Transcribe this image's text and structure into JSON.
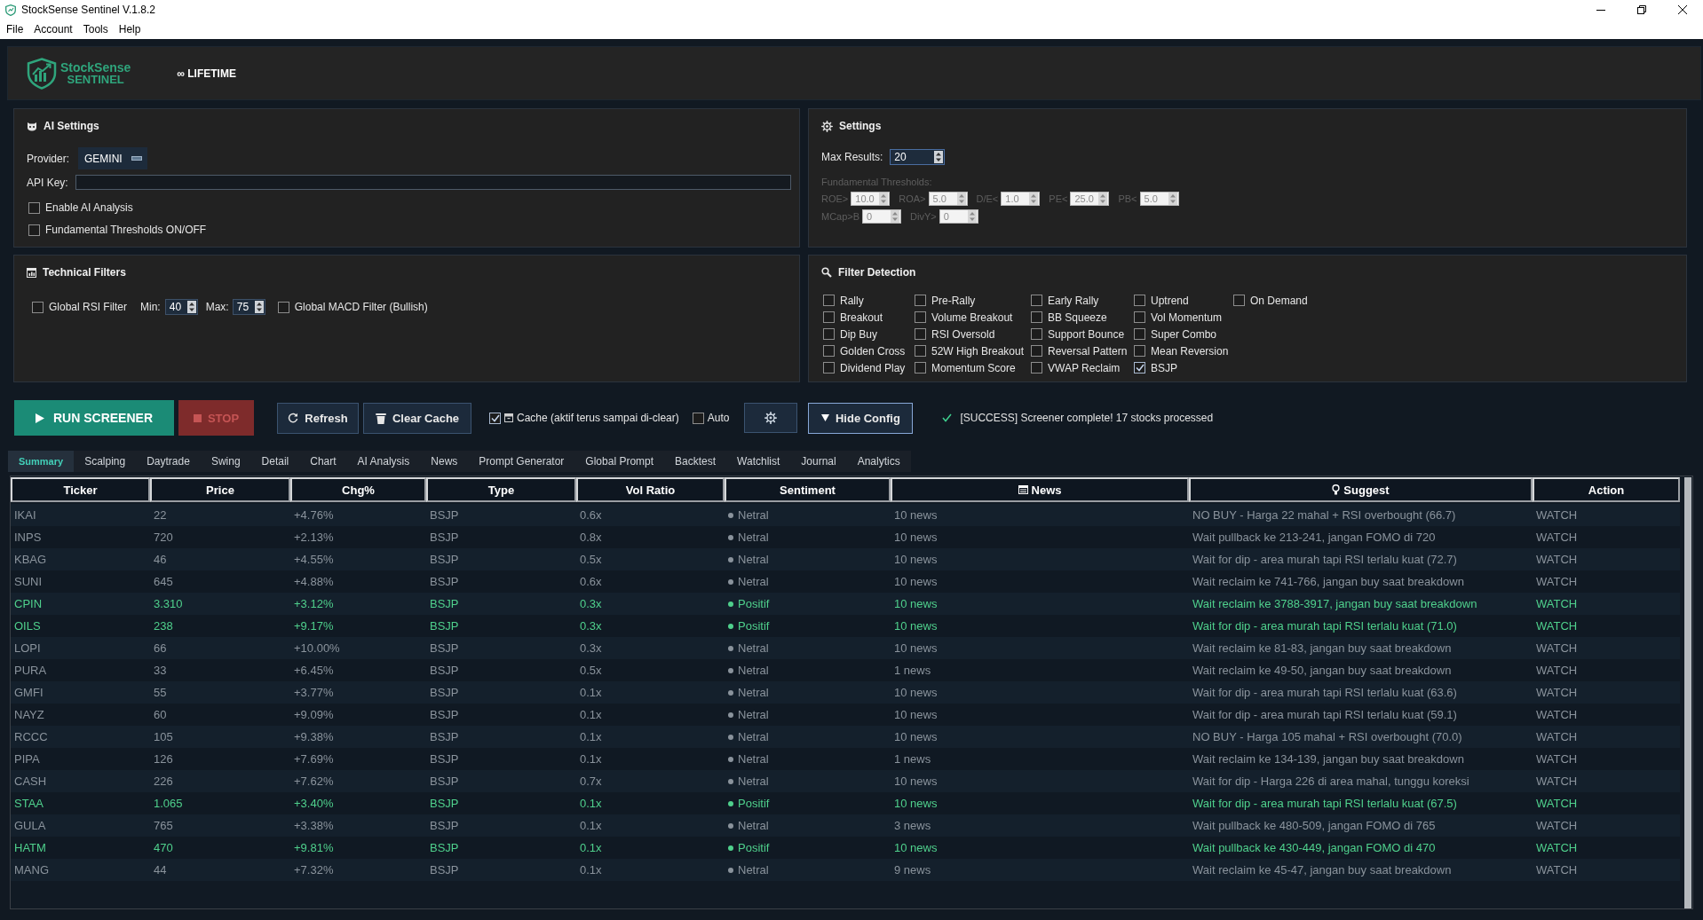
{
  "window": {
    "title": "StockSense Sentinel V.1.8.2"
  },
  "menu": [
    "File",
    "Account",
    "Tools",
    "Help"
  ],
  "header": {
    "logo_title": "StockSense",
    "logo_subtitle": "SENTINEL",
    "license": "∞ LIFETIME"
  },
  "ai_settings": {
    "title": "AI Settings",
    "provider_label": "Provider:",
    "provider": "GEMINI",
    "api_key_label": "API Key:",
    "checkboxes": [
      {
        "label": "Enable AI Analysis",
        "checked": false
      },
      {
        "label": "Fundamental Thresholds ON/OFF",
        "checked": false
      }
    ]
  },
  "settings": {
    "title": "Settings",
    "max_results_label": "Max Results:",
    "max_results": "20",
    "thresholds": {
      "label": "Fundamental Thresholds:",
      "disabled": true,
      "rows": [
        [
          {
            "label": "ROE>",
            "value": "10.0"
          },
          {
            "label": "ROA>",
            "value": "5.0"
          },
          {
            "label": "D/E<",
            "value": "1.0"
          },
          {
            "label": "PE<",
            "value": "25.0"
          },
          {
            "label": "PB<",
            "value": "5.0"
          }
        ],
        [
          {
            "label": "MCap>B",
            "value": "0"
          },
          {
            "label": "DivY>",
            "value": "0"
          }
        ]
      ]
    }
  },
  "technical_filters": {
    "title": "Technical Filters",
    "rsi_filter": {
      "label": "Global RSI Filter",
      "checked": false
    },
    "min_label": "Min:",
    "min": "40",
    "max_label": "Max:",
    "max": "75",
    "macd_filter": {
      "label": "Global MACD Filter (Bullish)",
      "checked": false
    }
  },
  "filter_detection": {
    "title": "Filter Detection",
    "columns": [
      [
        {
          "label": "Rally",
          "checked": false
        },
        {
          "label": "Breakout",
          "checked": false
        },
        {
          "label": "Dip Buy",
          "checked": false
        },
        {
          "label": "Golden Cross",
          "checked": false
        },
        {
          "label": "Dividend Play",
          "checked": false
        }
      ],
      [
        {
          "label": "Pre-Rally",
          "checked": false
        },
        {
          "label": "Volume Breakout",
          "checked": false
        },
        {
          "label": "RSI Oversold",
          "checked": false
        },
        {
          "label": "52W High Breakout",
          "checked": false
        },
        {
          "label": "Momentum Score",
          "checked": false
        }
      ],
      [
        {
          "label": "Early Rally",
          "checked": false
        },
        {
          "label": "BB Squeeze",
          "checked": false
        },
        {
          "label": "Support Bounce",
          "checked": false
        },
        {
          "label": "Reversal Pattern",
          "checked": false
        },
        {
          "label": "VWAP Reclaim",
          "checked": false
        }
      ],
      [
        {
          "label": "Uptrend",
          "checked": false
        },
        {
          "label": "Vol Momentum",
          "checked": false
        },
        {
          "label": "Super Combo",
          "checked": false
        },
        {
          "label": "Mean Reversion",
          "checked": false
        },
        {
          "label": "BSJP",
          "checked": true
        }
      ],
      [
        {
          "label": "On Demand",
          "checked": false
        }
      ]
    ]
  },
  "toolbar": {
    "items": [
      {
        "kind": "run",
        "label": "RUN SCREENER",
        "disabled": false
      },
      {
        "kind": "stop",
        "label": "STOP",
        "disabled": true
      },
      {
        "kind": "refresh",
        "label": "Refresh",
        "disabled": false
      },
      {
        "kind": "clear",
        "label": "Clear Cache",
        "disabled": false
      },
      {
        "kind": "cache",
        "label": "Cache (aktif terus sampai di-clear)",
        "checked": true
      },
      {
        "kind": "checkbox",
        "label": "Auto",
        "checked": false
      },
      {
        "kind": "settings",
        "disabled": false
      },
      {
        "kind": "collapse",
        "label": "Hide Config",
        "disabled": false
      }
    ],
    "status": "[SUCCESS] Screener complete! 17 stocks processed"
  },
  "tabs": [
    {
      "label": "Summary",
      "selected": true
    },
    {
      "label": "Scalping",
      "selected": false
    },
    {
      "label": "Daytrade",
      "selected": false
    },
    {
      "label": "Swing",
      "selected": false
    },
    {
      "label": "Detail",
      "selected": false
    },
    {
      "label": "Chart",
      "selected": false
    },
    {
      "label": "AI Analysis",
      "selected": false
    },
    {
      "label": "News",
      "selected": false
    },
    {
      "label": "Prompt Generator",
      "selected": false
    },
    {
      "label": "Global Prompt",
      "selected": false
    },
    {
      "label": "Backtest",
      "selected": false
    },
    {
      "label": "Watchlist",
      "selected": false
    },
    {
      "label": "Journal",
      "selected": false
    },
    {
      "label": "Analytics",
      "selected": false
    }
  ],
  "table": {
    "columns": [
      {
        "label": "Ticker",
        "kind": "text"
      },
      {
        "label": "Price",
        "kind": "text"
      },
      {
        "label": "Chg%",
        "kind": "text"
      },
      {
        "label": "Type",
        "kind": "text"
      },
      {
        "label": "Vol Ratio",
        "kind": "text"
      },
      {
        "label": "Sentiment",
        "kind": "sentiment"
      },
      {
        "label": "News",
        "kind": "news"
      },
      {
        "label": "Suggest",
        "kind": "suggest"
      },
      {
        "label": "Action",
        "kind": "text"
      }
    ],
    "rows": [
      {
        "color": "#8a939c",
        "cells": [
          "IKAI",
          "22",
          "+4.76%",
          "BSJP",
          "0.6x",
          "Netral",
          "10 news",
          "NO BUY - Harga 22 mahal + RSI overbought (66.7)",
          "WATCH"
        ]
      },
      {
        "color": "#8a939c",
        "cells": [
          "INPS",
          "720",
          "+2.13%",
          "BSJP",
          "0.8x",
          "Netral",
          "10 news",
          "Wait pullback ke 213-241, jangan FOMO di 720",
          "WATCH"
        ]
      },
      {
        "color": "#8a939c",
        "cells": [
          "KBAG",
          "46",
          "+4.55%",
          "BSJP",
          "0.5x",
          "Netral",
          "10 news",
          "Wait for dip - area murah tapi RSI terlalu kuat (72.7)",
          "WATCH"
        ]
      },
      {
        "color": "#8a939c",
        "cells": [
          "SUNI",
          "645",
          "+4.88%",
          "BSJP",
          "0.6x",
          "Netral",
          "10 news",
          "Wait reclaim ke 741-766, jangan buy saat breakdown",
          "WATCH"
        ]
      },
      {
        "color": "#4fd08c",
        "cells": [
          "CPIN",
          "3.310",
          "+3.12%",
          "BSJP",
          "0.3x",
          "Positif",
          "10 news",
          "Wait reclaim ke 3788-3917, jangan buy saat breakdown",
          "WATCH"
        ]
      },
      {
        "color": "#4fd08c",
        "cells": [
          "OILS",
          "238",
          "+9.17%",
          "BSJP",
          "0.3x",
          "Positif",
          "10 news",
          "Wait for dip - area murah tapi RSI terlalu kuat (71.0)",
          "WATCH"
        ]
      },
      {
        "color": "#8a939c",
        "cells": [
          "LOPI",
          "66",
          "+10.00%",
          "BSJP",
          "0.3x",
          "Netral",
          "10 news",
          "Wait reclaim ke 81-83, jangan buy saat breakdown",
          "WATCH"
        ]
      },
      {
        "color": "#8a939c",
        "cells": [
          "PURA",
          "33",
          "+6.45%",
          "BSJP",
          "0.5x",
          "Netral",
          "1 news",
          "Wait reclaim ke 49-50, jangan buy saat breakdown",
          "WATCH"
        ]
      },
      {
        "color": "#8a939c",
        "cells": [
          "GMFI",
          "55",
          "+3.77%",
          "BSJP",
          "0.1x",
          "Netral",
          "10 news",
          "Wait for dip - area murah tapi RSI terlalu kuat (63.6)",
          "WATCH"
        ]
      },
      {
        "color": "#8a939c",
        "cells": [
          "NAYZ",
          "60",
          "+9.09%",
          "BSJP",
          "0.1x",
          "Netral",
          "10 news",
          "Wait for dip - area murah tapi RSI terlalu kuat (59.1)",
          "WATCH"
        ]
      },
      {
        "color": "#8a939c",
        "cells": [
          "RCCC",
          "105",
          "+9.38%",
          "BSJP",
          "0.1x",
          "Netral",
          "10 news",
          "NO BUY - Harga 105 mahal + RSI overbought (70.0)",
          "WATCH"
        ]
      },
      {
        "color": "#8a939c",
        "cells": [
          "PIPA",
          "126",
          "+7.69%",
          "BSJP",
          "0.1x",
          "Netral",
          "1 news",
          "Wait reclaim ke 134-139, jangan buy saat breakdown",
          "WATCH"
        ]
      },
      {
        "color": "#8a939c",
        "cells": [
          "CASH",
          "226",
          "+7.62%",
          "BSJP",
          "0.7x",
          "Netral",
          "10 news",
          "Wait for dip - Harga 226 di area mahal, tunggu koreksi",
          "WATCH"
        ]
      },
      {
        "color": "#4fd08c",
        "cells": [
          "STAA",
          "1.065",
          "+3.40%",
          "BSJP",
          "0.1x",
          "Positif",
          "10 news",
          "Wait for dip - area murah tapi RSI terlalu kuat (67.5)",
          "WATCH"
        ]
      },
      {
        "color": "#8a939c",
        "cells": [
          "GULA",
          "765",
          "+3.38%",
          "BSJP",
          "0.1x",
          "Netral",
          "3 news",
          "Wait pullback ke 480-509, jangan FOMO di 765",
          "WATCH"
        ]
      },
      {
        "color": "#4fd08c",
        "cells": [
          "HATM",
          "470",
          "+9.81%",
          "BSJP",
          "0.1x",
          "Positif",
          "10 news",
          "Wait pullback ke 430-449, jangan FOMO di 470",
          "WATCH"
        ]
      },
      {
        "color": "#8a939c",
        "cells": [
          "MANG",
          "44",
          "+7.32%",
          "BSJP",
          "0.1x",
          "Netral",
          "9 news",
          "Wait reclaim ke 45-47, jangan buy saat breakdown",
          "WATCH"
        ]
      }
    ]
  }
}
